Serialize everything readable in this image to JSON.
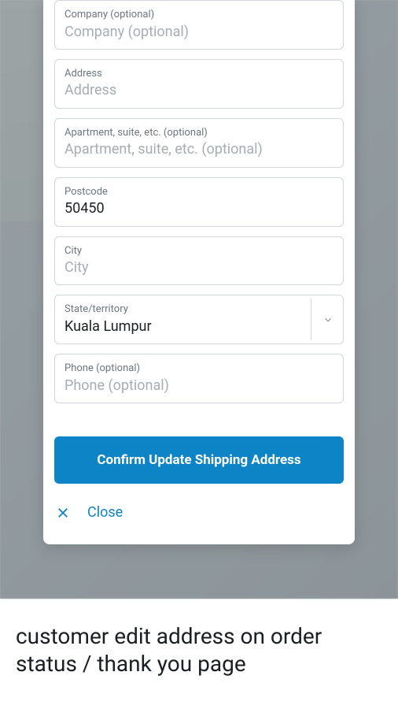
{
  "form": {
    "company": {
      "label": "Company (optional)",
      "placeholder": "Company (optional)",
      "value": ""
    },
    "address": {
      "label": "Address",
      "placeholder": "Address",
      "value": ""
    },
    "apartment": {
      "label": "Apartment, suite, etc. (optional)",
      "placeholder": "Apartment, suite, etc. (optional)",
      "value": ""
    },
    "postcode": {
      "label": "Postcode",
      "placeholder": "Postcode",
      "value": "50450"
    },
    "city": {
      "label": "City",
      "placeholder": "City",
      "value": ""
    },
    "state": {
      "label": "State/territory",
      "value": "Kuala Lumpur"
    },
    "phone": {
      "label": "Phone (optional)",
      "placeholder": "Phone (optional)",
      "value": ""
    }
  },
  "buttons": {
    "confirm": "Confirm Update Shipping Address",
    "close": "Close"
  },
  "caption": "customer edit address on order status / thank you page"
}
